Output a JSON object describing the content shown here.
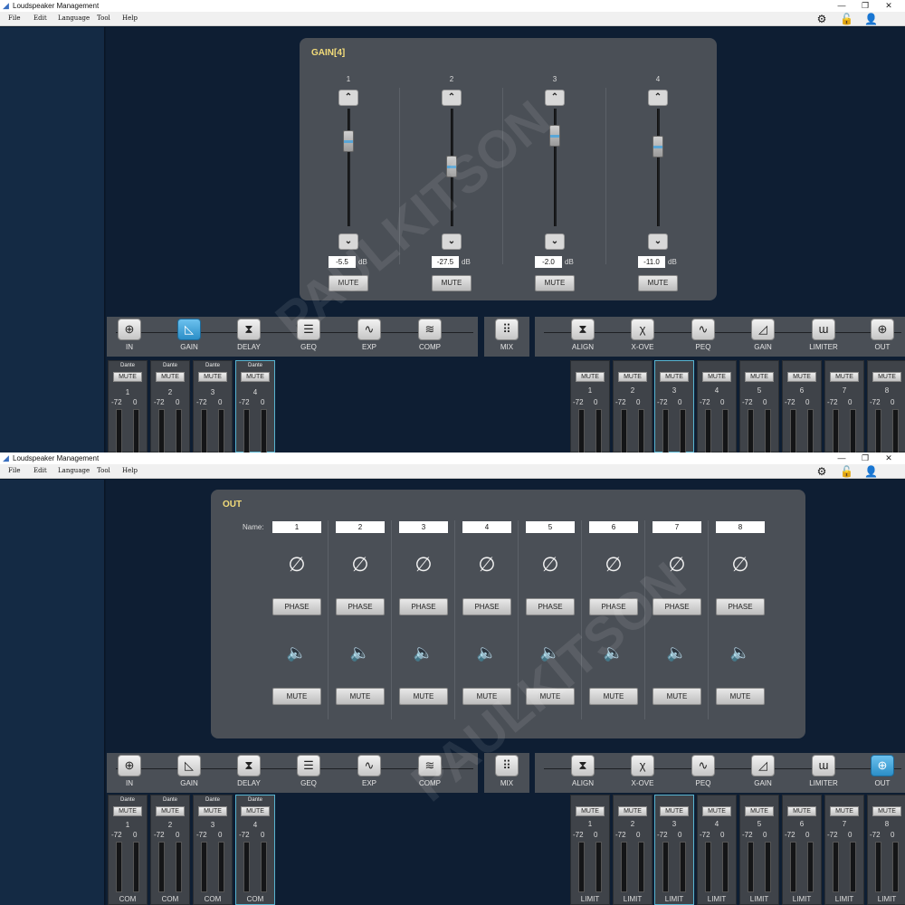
{
  "window": {
    "title": "Loudspeaker Management",
    "minimize": "—",
    "restore": "❐",
    "close": "✕"
  },
  "menu": [
    "File",
    "Edit",
    "Language",
    "Tool",
    "Help"
  ],
  "menu_icons": [
    "gear-icon",
    "lock-icon",
    "user-icon"
  ],
  "watermark": "PAULKITSON",
  "gain_panel": {
    "title": "GAIN[4]",
    "unit": "dB",
    "mute_label": "MUTE",
    "channels": [
      {
        "num": "1",
        "value": "-5.5"
      },
      {
        "num": "2",
        "value": "-27.5"
      },
      {
        "num": "3",
        "value": "-2.0"
      },
      {
        "num": "4",
        "value": "-11.0"
      }
    ]
  },
  "out_panel": {
    "title": "OUT",
    "name_label": "Name:",
    "phase_label": "PHASE",
    "mute_label": "MUTE",
    "phase_symbol": "∅",
    "speaker_symbol": "🔈",
    "channels": [
      "1",
      "2",
      "3",
      "4",
      "5",
      "6",
      "7",
      "8"
    ]
  },
  "input_toolbar": [
    {
      "label": "IN",
      "icon": "in-icon",
      "glyph": "⊕"
    },
    {
      "label": "GAIN",
      "icon": "gain-icon",
      "glyph": "◺"
    },
    {
      "label": "DELAY",
      "icon": "delay-icon",
      "glyph": "⧗"
    },
    {
      "label": "GEQ",
      "icon": "geq-icon",
      "glyph": "☰"
    },
    {
      "label": "EXP",
      "icon": "exp-icon",
      "glyph": "∿"
    },
    {
      "label": "COMP",
      "icon": "comp-icon",
      "glyph": "≋"
    }
  ],
  "mix_button": {
    "label": "MIX",
    "icon": "mix-icon",
    "glyph": "⠿"
  },
  "output_toolbar": [
    {
      "label": "ALIGN",
      "icon": "align-icon",
      "glyph": "⧗"
    },
    {
      "label": "X-OVE",
      "icon": "crossover-icon",
      "glyph": "χ"
    },
    {
      "label": "PEQ",
      "icon": "peq-icon",
      "glyph": "∿"
    },
    {
      "label": "GAIN",
      "icon": "gain-icon",
      "glyph": "◿"
    },
    {
      "label": "LIMITER",
      "icon": "limiter-icon",
      "glyph": "ɯ"
    },
    {
      "label": "OUT",
      "icon": "out-icon",
      "glyph": "⊕"
    }
  ],
  "input_strips": {
    "badge": "Dante",
    "mute_label": "MUTE",
    "range": "-72",
    "range_max": "0",
    "footer": "COM",
    "channels": [
      "1",
      "2",
      "3",
      "4"
    ]
  },
  "output_strips": {
    "mute_label": "MUTE",
    "range": "-72",
    "range_max": "0",
    "footer": "LIMIT",
    "channels": [
      "1",
      "2",
      "3",
      "4",
      "5",
      "6",
      "7",
      "8"
    ]
  },
  "colors": {
    "panel": "#4a4f56",
    "title_accent": "#f3dc7a",
    "active_button": "#2b8ec7",
    "background": "#0e1e33"
  }
}
